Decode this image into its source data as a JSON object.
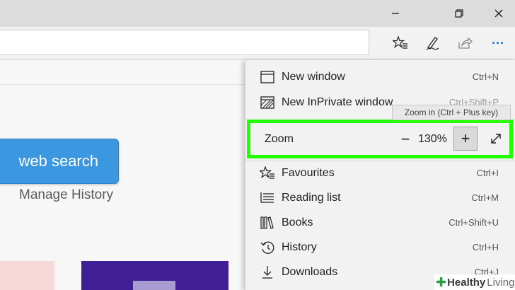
{
  "window_controls": {
    "minimize_icon": "minimize-icon",
    "restore_icon": "restore-icon",
    "close_icon": "close-icon"
  },
  "toolbar": {
    "favorites_icon": "favorites-star-icon",
    "notes_icon": "pen-icon",
    "share_icon": "share-icon",
    "more_label": "···"
  },
  "page": {
    "search_button": "web search",
    "manage_history": "Manage History"
  },
  "menu": {
    "items_top": [
      {
        "label": "New window",
        "shortcut": "Ctrl+N",
        "icon": "window-icon"
      },
      {
        "label": "New InPrivate window",
        "shortcut": "Ctrl+Shift+P",
        "icon": "inprivate-icon"
      }
    ],
    "zoom": {
      "label": "Zoom",
      "minus": "−",
      "value": "130%",
      "plus": "+",
      "fullscreen_icon": "fullscreen-icon"
    },
    "tooltip": "Zoom in (Ctrl + Plus key)",
    "items_bottom": [
      {
        "label": "Favourites",
        "shortcut": "Ctrl+I",
        "icon": "favourites-icon"
      },
      {
        "label": "Reading list",
        "shortcut": "Ctrl+M",
        "icon": "reading-list-icon"
      },
      {
        "label": "Books",
        "shortcut": "Ctrl+Shift+U",
        "icon": "books-icon"
      },
      {
        "label": "History",
        "shortcut": "Ctrl+H",
        "icon": "history-icon"
      },
      {
        "label": "Downloads",
        "shortcut": "Ctrl+J",
        "icon": "download-icon"
      }
    ]
  },
  "watermark": {
    "brand": "Healthy",
    "suffix": "Living"
  },
  "colors": {
    "highlight": "#22ff00",
    "search_button": "#3a97e0",
    "tile_purple": "#3f1f93"
  }
}
